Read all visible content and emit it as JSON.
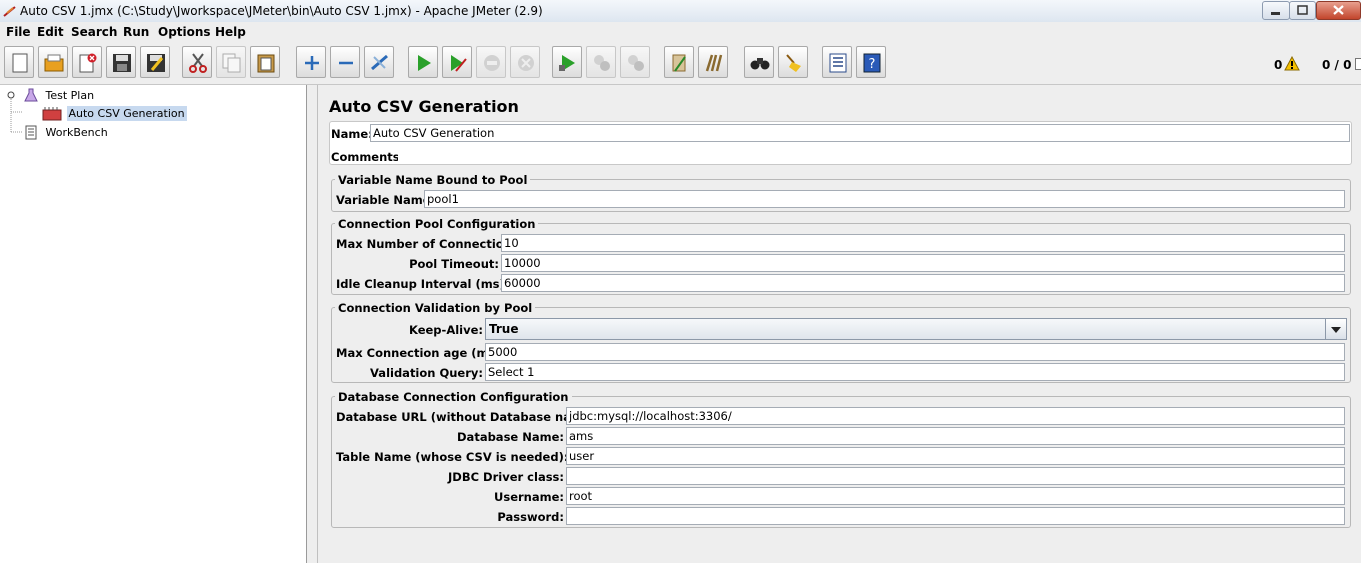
{
  "window": {
    "title": "Auto CSV 1.jmx (C:\\Study\\Jworkspace\\JMeter\\bin\\Auto CSV 1.jmx) - Apache JMeter (2.9)"
  },
  "menu": {
    "items": [
      "File",
      "Edit",
      "Search",
      "Run",
      "Options",
      "Help"
    ]
  },
  "toolbar": {
    "buttons": [
      "new-icon",
      "open-icon",
      "close-icon",
      "save-icon",
      "save-as-icon",
      "cut-icon",
      "copy-icon",
      "paste-icon",
      "expand-icon",
      "collapse-icon",
      "toggle-icon",
      "start-icon",
      "start-no-pause-icon",
      "stop-icon",
      "shutdown-icon",
      "remote-start-icon",
      "remote-stop-icon",
      "remote-shutdown-icon",
      "clear-icon",
      "clear-all-icon",
      "search-icon",
      "reset-search-icon",
      "function-helper-icon",
      "help-icon"
    ],
    "warnings_count": "0",
    "threads_count": "0 / 0",
    "warning_color": "#f5c000"
  },
  "tree": {
    "items": [
      {
        "label": "Test Plan",
        "icon": "flask-icon"
      },
      {
        "label": "Auto CSV Generation",
        "icon": "jdbc-config-icon",
        "selected": true
      },
      {
        "label": "WorkBench",
        "icon": "workbench-icon"
      }
    ]
  },
  "panel": {
    "title": "Auto CSV Generation",
    "name_label": "Name:",
    "name_value": "Auto CSV Generation",
    "comments_label": "Comments:",
    "variable_group": {
      "title": "Variable Name Bound to Pool",
      "label": "Variable Name:",
      "value": "pool1"
    },
    "pool_group": {
      "title": "Connection Pool Configuration",
      "max_conn_label": "Max Number of Connections:",
      "max_conn_value": "10",
      "timeout_label": "Pool Timeout:",
      "timeout_value": "10000",
      "idle_label": "Idle Cleanup Interval (ms):",
      "idle_value": "60000"
    },
    "validation_group": {
      "title": "Connection Validation by Pool",
      "keepalive_label": "Keep-Alive:",
      "keepalive_value": "True",
      "age_label": "Max Connection age (ms):",
      "age_value": "5000",
      "query_label": "Validation Query:",
      "query_value": "Select 1"
    },
    "db_group": {
      "title": "Database Connection Configuration",
      "url_label": "Database URL (without Database name):",
      "url_value": "jdbc:mysql://localhost:3306/",
      "dbname_label": "Database Name:",
      "dbname_value": "ams",
      "table_label": "Table Name (whose CSV is needed):",
      "table_value": "user",
      "driver_label": "JDBC Driver class:",
      "driver_value": "",
      "user_label": "Username:",
      "user_value": "root",
      "pass_label": "Password:",
      "pass_value": ""
    }
  }
}
